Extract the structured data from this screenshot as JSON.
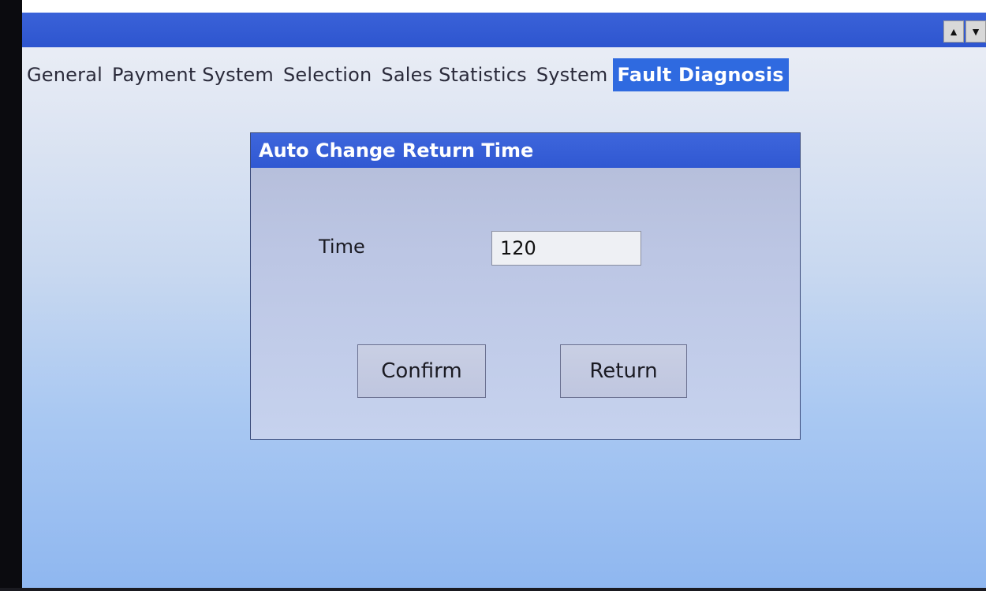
{
  "title_bar": {
    "scroll_up_icon": "triangle-up",
    "scroll_down_icon": "triangle-down"
  },
  "menu": {
    "items": [
      {
        "label": "General",
        "active": false
      },
      {
        "label": "Payment System",
        "active": false
      },
      {
        "label": "Selection",
        "active": false
      },
      {
        "label": "Sales Statistics",
        "active": false
      },
      {
        "label": "System",
        "active": false
      },
      {
        "label": "Fault Diagnosis",
        "active": true
      }
    ]
  },
  "dialog": {
    "title": "Auto Change Return Time",
    "time_label": "Time",
    "time_value": "120",
    "confirm_label": "Confirm",
    "return_label": "Return"
  },
  "colors": {
    "title_bar": "#2e55cf",
    "active_tab": "#2f6ae0",
    "dialog_title": "#3058d2"
  }
}
